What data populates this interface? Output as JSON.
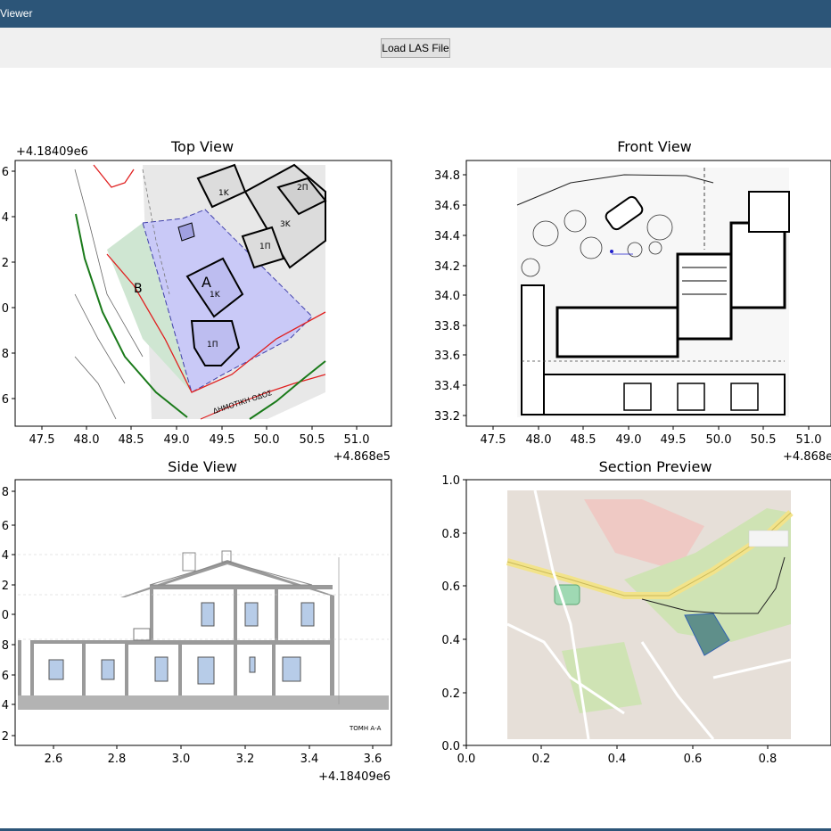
{
  "window": {
    "title": "Viewer"
  },
  "toolbar": {
    "load_button": "Load LAS File"
  },
  "chart_data": [
    {
      "type": "image",
      "title": "Top View",
      "x_ticks": [
        "47.5",
        "48.0",
        "48.5",
        "49.0",
        "49.5",
        "50.0",
        "50.5",
        "51.0"
      ],
      "y_ticks": [
        "6",
        "4",
        "2",
        "0",
        "8",
        "6"
      ],
      "x_offset": "+4.868e5",
      "y_offset": "+4.18409e6",
      "image_labels": [
        "A",
        "B",
        "1K",
        "1K",
        "2Π",
        "3K",
        "1Π",
        "1Π",
        "ΔΗΜΟΤΙΚΗ ΟΔΟΣ"
      ]
    },
    {
      "type": "image",
      "title": "Front View",
      "x_ticks": [
        "47.5",
        "48.0",
        "48.5",
        "49.0",
        "49.5",
        "50.0",
        "50.5",
        "51.0"
      ],
      "y_ticks": [
        "34.8",
        "34.6",
        "34.4",
        "34.2",
        "34.0",
        "33.8",
        "33.6",
        "33.4",
        "33.2"
      ],
      "x_offset": "+4.868e"
    },
    {
      "type": "image",
      "title": "Side View",
      "x_ticks": [
        "2.6",
        "2.8",
        "3.0",
        "3.2",
        "3.4",
        "3.6"
      ],
      "y_ticks": [
        "8",
        "6",
        "4",
        "2",
        "0",
        "8",
        "6",
        "4",
        "2"
      ],
      "x_offset": "+4.18409e6",
      "image_labels": [
        "ΤΟΜΗ Α-Α"
      ]
    },
    {
      "type": "image",
      "title": "Section Preview",
      "x_ticks": [
        "0.0",
        "0.2",
        "0.4",
        "0.6",
        "0.8"
      ],
      "y_ticks": [
        "1.0",
        "0.8",
        "0.6",
        "0.4",
        "0.2",
        "0.0"
      ],
      "xlim": [
        0,
        1
      ],
      "ylim": [
        0,
        1
      ]
    }
  ]
}
